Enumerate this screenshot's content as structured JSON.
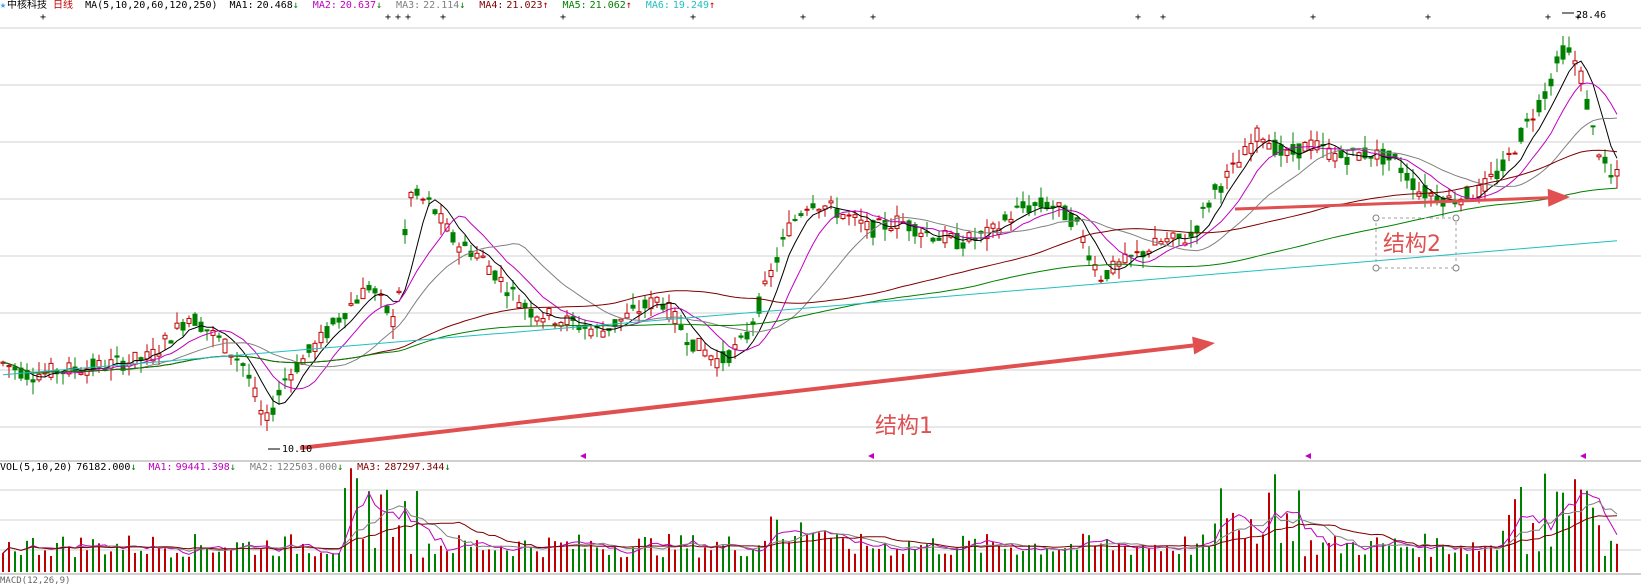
{
  "header": {
    "star_glyph": "★",
    "stock_name": "中核科技",
    "period": "日线",
    "ma_params": "MA(5,10,20,60,120,250)",
    "ma_items": [
      {
        "label": "MA1:",
        "value": "20.468",
        "arrow": "↓",
        "color": "#000000"
      },
      {
        "label": "MA2:",
        "value": "20.637",
        "arrow": "↓",
        "color": "#c000c0"
      },
      {
        "label": "MA3:",
        "value": "22.114",
        "arrow": "↓",
        "color": "#808080"
      },
      {
        "label": "MA4:",
        "value": "21.023",
        "arrow": "↑",
        "color": "#800000"
      },
      {
        "label": "MA5:",
        "value": "21.062",
        "arrow": "↑",
        "color": "#008000"
      },
      {
        "label": "MA6:",
        "value": "19.249",
        "arrow": "↑",
        "color": "#20c0c0"
      }
    ]
  },
  "vol_header": {
    "params": "VOL(5,10,20)",
    "vol_value": "76182.000",
    "vol_arrow": "↓",
    "items": [
      {
        "label": "MA1:",
        "value": "99441.398",
        "arrow": "↓",
        "color": "#c000c0"
      },
      {
        "label": "MA2:",
        "value": "122503.000",
        "arrow": "↓",
        "color": "#808080"
      },
      {
        "label": "MA3:",
        "value": "287297.344",
        "arrow": "↓",
        "color": "#800000"
      }
    ]
  },
  "macd_header": {
    "text": "MACD(12,26,9)"
  },
  "annotations": {
    "low_label": "10.10",
    "high_label": "28.46",
    "structure1": "结构1",
    "structure2": "结构2"
  },
  "colors": {
    "up": "#c00000",
    "down": "#008000",
    "grid": "#d0d0d0",
    "arrow": "#e05050",
    "cyan": "#20c0c0",
    "marker": "#c000c0"
  },
  "chart_data": {
    "type": "candlestick",
    "title": "中核科技 日线",
    "ylim": [
      9,
      30
    ],
    "low_close": 10.1,
    "high_close": 28.46
  }
}
